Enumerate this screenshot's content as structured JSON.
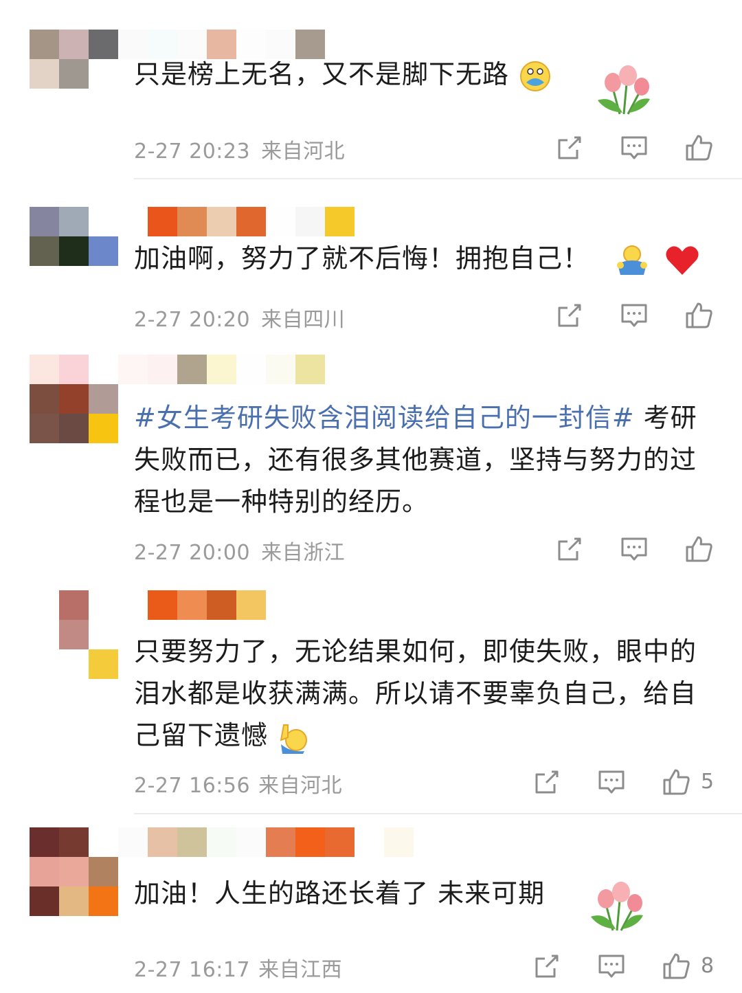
{
  "comments": [
    {
      "text": "只是榜上无名，又不是脚下无路",
      "time": "2-27 20:23",
      "location": "来自河北",
      "likes": "",
      "avatar_colors": [
        "#a49587",
        "#cdb2b4",
        "#6b6b6e",
        "#e3d2c6",
        "#9f9890",
        "#ffffff",
        "#ffffff",
        "#ffffff",
        "#ffffff"
      ],
      "username_colors": [
        "#fafafa",
        "#f6fbfb",
        "#fbfbfb",
        "#e7b7a1",
        "#fdfdfd",
        "#fbfbfb",
        "#a79b8f"
      ],
      "emoji_names": [
        "hug-face-emoji",
        "tulip-bouquet"
      ]
    },
    {
      "text": "加油啊，努力了就不后悔！拥抱自己！",
      "time": "2-27 20:20",
      "location": "来自四川",
      "likes": "",
      "avatar_colors": [
        "#86859f",
        "#a0a9b6",
        "#ffffff",
        "#63614f",
        "#1f2e1a",
        "#6d87cb",
        "#ffffff",
        "#ffffff",
        "#ffffff"
      ],
      "username_colors": [
        "#ffffff",
        "#e9551b",
        "#e08b54",
        "#eccdaf",
        "#e0672e",
        "#fefefe",
        "#f6f6f6",
        "#f6c92a"
      ],
      "emoji_names": [
        "hug-emoji",
        "red-heart-emoji"
      ]
    },
    {
      "hashtag": "#女生考研失败含泪阅读给自己的一封信#",
      "text": " 考研失败而已，还有很多其他赛道，坚持与努力的过程也是一种特别的经历。",
      "time": "2-27 20:00",
      "location": "来自浙江",
      "likes": "",
      "avatar_colors": [
        "#fce7e0",
        "#fad3d9",
        "#ffffff",
        "#7b4e40",
        "#93412b",
        "#b09b97",
        "#7a5349",
        "#6a4a43",
        "#f8c412"
      ],
      "username_colors": [
        "#fdf6f4",
        "#fdf1f1",
        "#b1a48f",
        "#fbf6cf",
        "#fefefe",
        "#fbfbf2",
        "#eee4a1"
      ]
    },
    {
      "text": "只要努力了，无论结果如何，即使失败，眼中的泪水都是收获满满。所以请不要辜负自己，给自己留下遗憾",
      "time": "2-27 16:56",
      "location": "来自河北",
      "likes": "5",
      "avatar_colors": [
        "#ffffff",
        "#b76f67",
        "#ffffff",
        "#ffffff",
        "#c28a84",
        "#ffffff",
        "#ffffff",
        "#ffffff",
        "#f4cb3a"
      ],
      "username_colors": [
        "#ffffff",
        "#ea5b1a",
        "#ee8c52",
        "#cd5d23",
        "#f3c662"
      ],
      "emoji_names": [
        "raised-hand-emoji"
      ]
    },
    {
      "text": "加油！人生的路还长着了 未来可期",
      "time": "2-27 16:17",
      "location": "来自江西",
      "likes": "8",
      "avatar_colors": [
        "#6a2f2c",
        "#773a31",
        "#ffffff",
        "#e8a399",
        "#e9a89a",
        "#b08260",
        "#6a2f29",
        "#e3b883",
        "#f37414"
      ],
      "username_colors": [
        "#fbfbfb",
        "#e7c1a6",
        "#cfc39b",
        "#f6fbf6",
        "#fbfbfb",
        "#e47d52",
        "#f3601a",
        "#e96a30",
        "#ffffff",
        "#fdf8ec"
      ],
      "emoji_names": [
        "tulip-bouquet"
      ]
    }
  ],
  "icons": [
    "share-icon",
    "comment-icon",
    "like-icon"
  ],
  "colors": {
    "hashtag": "#4a6fae",
    "meta": "#9a9a9a",
    "icon": "#8c8c8c"
  }
}
